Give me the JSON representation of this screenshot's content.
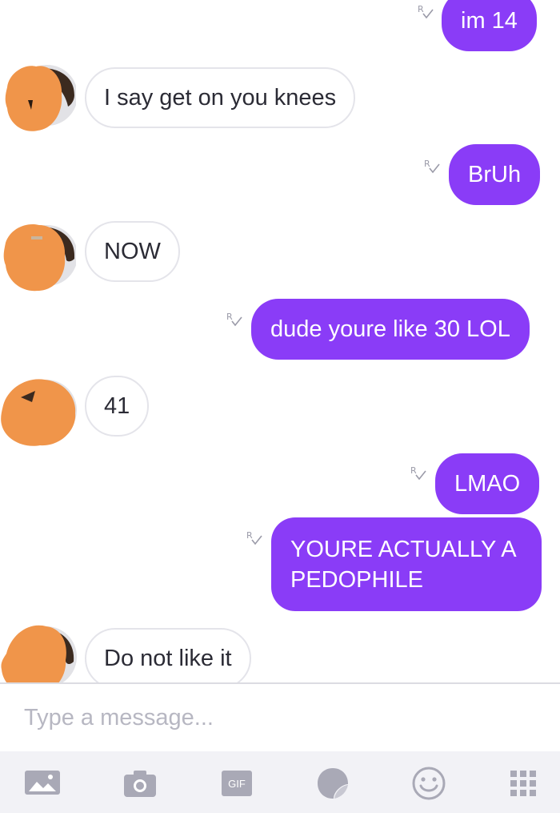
{
  "messages": [
    {
      "id": "m1",
      "direction": "out",
      "text": "im 14"
    },
    {
      "id": "m2",
      "direction": "in",
      "text": "I say get on you knees"
    },
    {
      "id": "m3",
      "direction": "out",
      "text": "BrUh"
    },
    {
      "id": "m4",
      "direction": "in",
      "text": "NOW"
    },
    {
      "id": "m5",
      "direction": "out",
      "text": "dude youre like 30 LOL"
    },
    {
      "id": "m6",
      "direction": "in",
      "text": "41"
    },
    {
      "id": "m7",
      "direction": "out",
      "text": "LMAO"
    },
    {
      "id": "m8",
      "direction": "out",
      "text": "YOURE ACTUALLY A PEDOPHILE"
    },
    {
      "id": "m9",
      "direction": "in",
      "text": "Do not like it"
    }
  ],
  "composer": {
    "placeholder": "Type a message..."
  },
  "toolbar": {
    "items": [
      {
        "name": "gallery-icon"
      },
      {
        "name": "camera-icon"
      },
      {
        "name": "gif-icon",
        "label": "GIF"
      },
      {
        "name": "sticker-icon"
      },
      {
        "name": "emoji-icon"
      },
      {
        "name": "apps-grid-icon"
      }
    ]
  },
  "colors": {
    "outgoing_bubble": "#8a3cf7",
    "incoming_border": "#e4e4ea",
    "toolbar_icon": "#a9a9b6",
    "toolbar_bg": "#f2f2f6",
    "avatar_redaction": "#f0954a"
  },
  "receipt_mark": "R"
}
